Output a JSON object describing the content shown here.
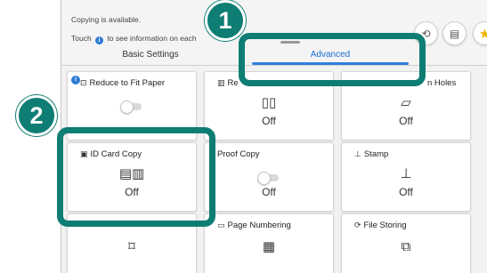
{
  "status": {
    "line1": "Copying is available.",
    "line2_prefix": "Touch",
    "line2_suffix": "to see information on each"
  },
  "tabs": {
    "basic": "Basic Settings",
    "advanced": "Advanced"
  },
  "cards": {
    "reduce_to_fit": {
      "label": "Reduce to Fit Paper"
    },
    "book_copy": {
      "label": "Re",
      "value": "Off"
    },
    "punch_holes": {
      "label": "n Holes",
      "value": "Off"
    },
    "id_card_copy": {
      "label": "ID Card Copy",
      "value": "Off"
    },
    "proof_copy": {
      "label": "Proof Copy",
      "value": "Off"
    },
    "stamp": {
      "label": "Stamp",
      "value": "Off"
    },
    "page_numbering": {
      "label": "Page Numbering"
    },
    "file_storing": {
      "label": "File Storing"
    }
  },
  "callouts": {
    "one": "1",
    "two": "2"
  },
  "colors": {
    "callout": "#0e7d73",
    "tab_accent": "#2d7fe0",
    "info": "#2e7bd6"
  }
}
